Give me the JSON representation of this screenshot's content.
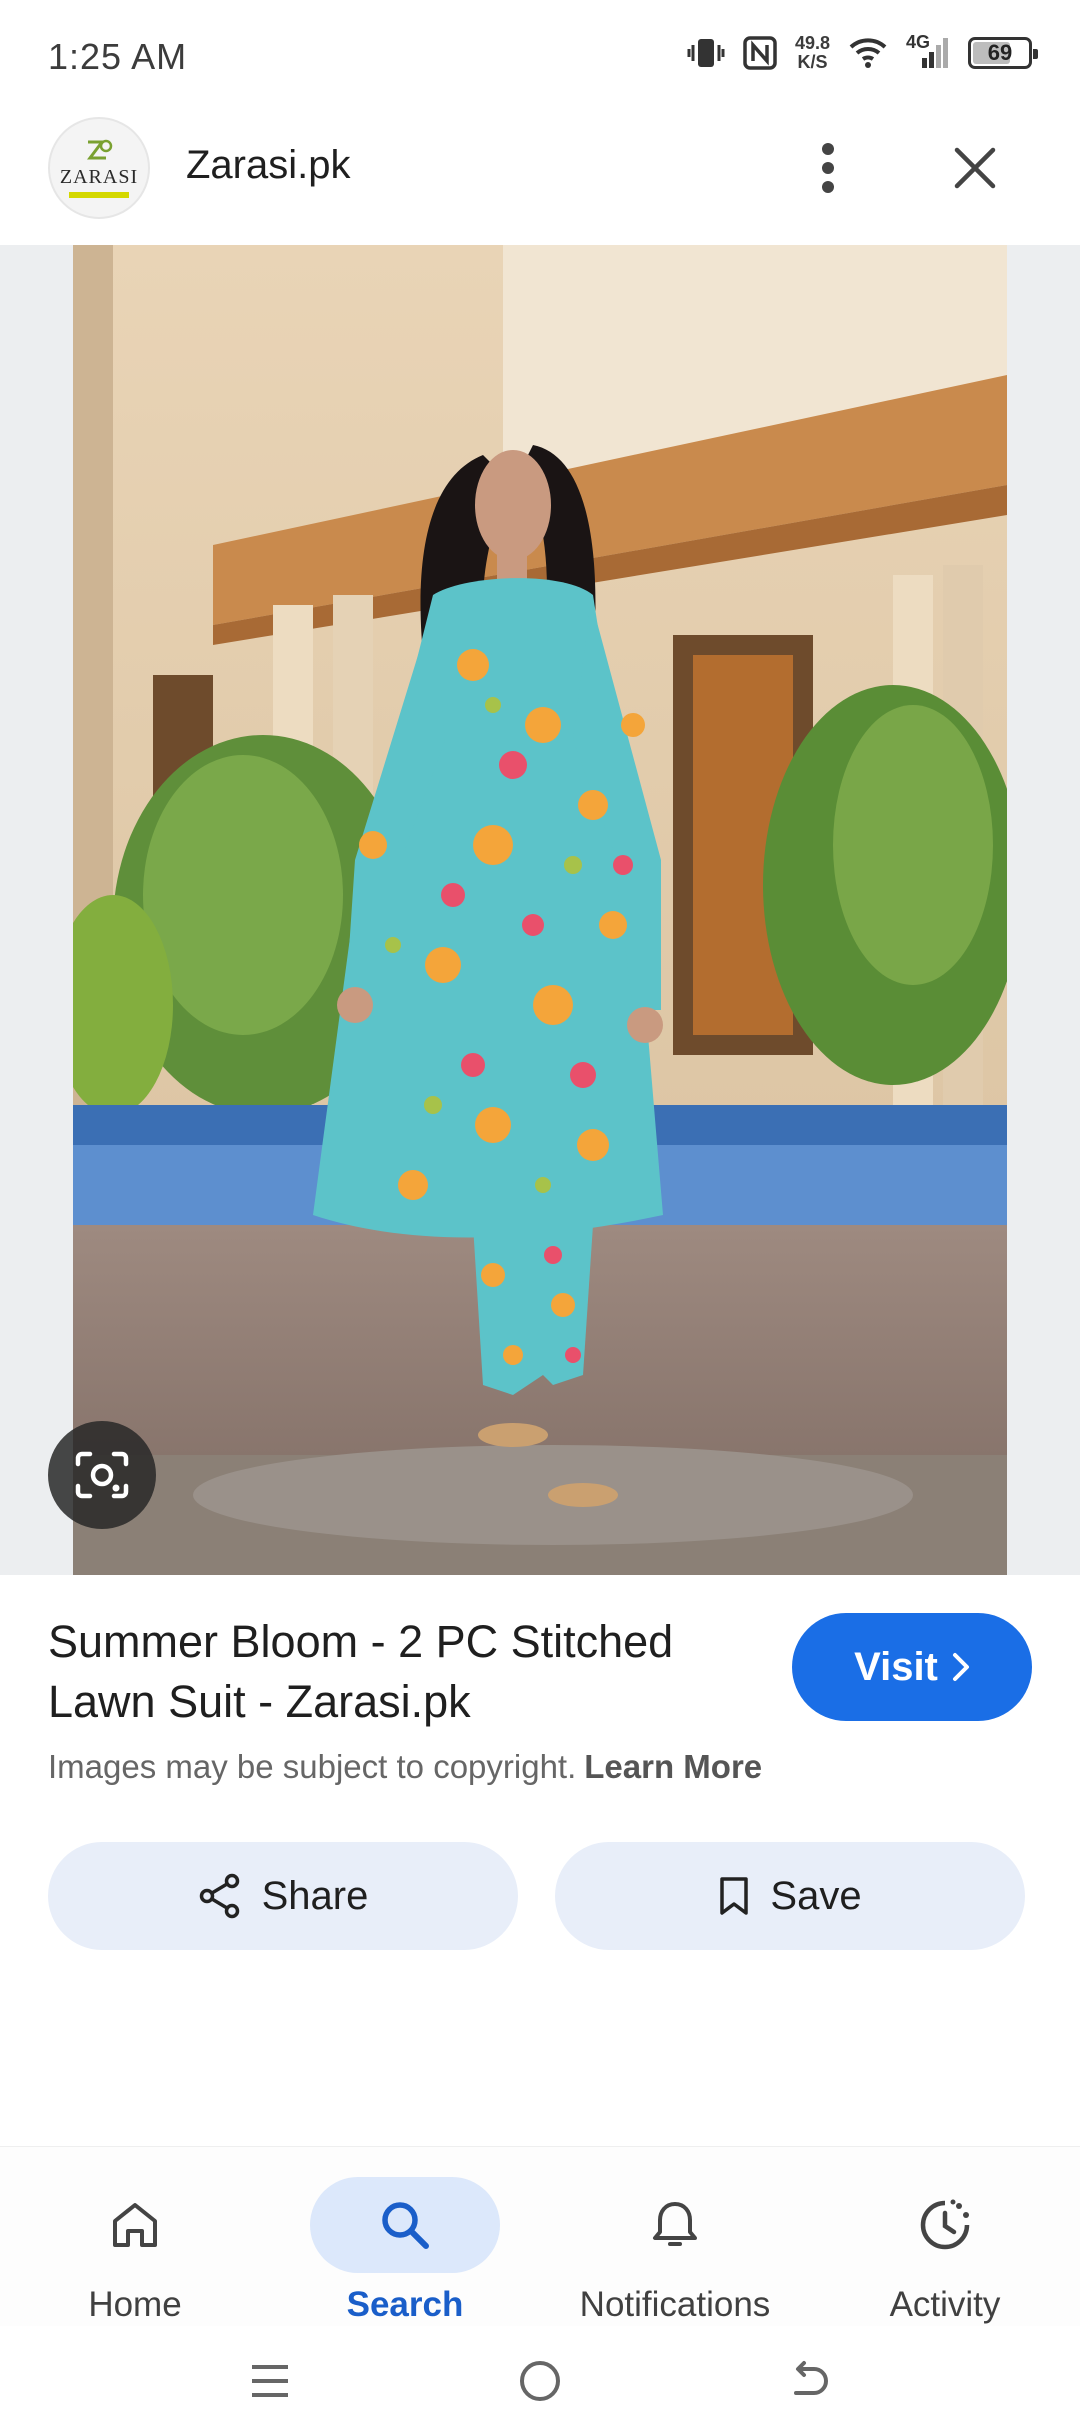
{
  "status_bar": {
    "time": "1:25 AM",
    "net_speed_value": "49.8",
    "net_speed_unit": "K/S",
    "network_type": "4G",
    "battery_level": "69",
    "battery_fraction": 0.69
  },
  "header": {
    "logo_text": "ZARASI",
    "site_name": "Zarasi.pk",
    "more_icon": "more-vert-icon",
    "close_icon": "close-icon"
  },
  "image": {
    "lens_icon": "lens-icon"
  },
  "product": {
    "title": "Summer Bloom - 2 PC Stitched Lawn Suit - Zarasi.pk",
    "visit_label": "Visit",
    "copyright_text": "Images may be subject to copyright.",
    "learn_more": "Learn More"
  },
  "actions": {
    "share_label": "Share",
    "save_label": "Save"
  },
  "bottom_nav": {
    "items": [
      {
        "label": "Home",
        "icon": "home-icon",
        "active": false
      },
      {
        "label": "Search",
        "icon": "search-icon",
        "active": true
      },
      {
        "label": "Notifications",
        "icon": "bell-icon",
        "active": false
      },
      {
        "label": "Activity",
        "icon": "activity-icon",
        "active": false
      }
    ]
  },
  "colors": {
    "accent": "#1a6ee6",
    "active_nav_bg": "#dce8fb",
    "action_button_bg": "#e8eef9"
  }
}
